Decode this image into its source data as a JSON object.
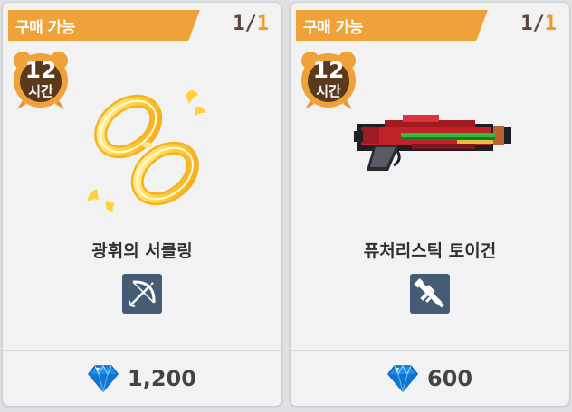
{
  "cards": [
    {
      "purchase_label": "구매 가능",
      "stock_current": "1",
      "stock_sep": "/",
      "stock_max": "1",
      "timer_value": "12",
      "timer_unit": "시간",
      "item_name": "광휘의 서클링",
      "type_icon": "bow-icon",
      "price": "1,200",
      "currency_icon": "diamond-icon"
    },
    {
      "purchase_label": "구매 가능",
      "stock_current": "1",
      "stock_sep": "/",
      "stock_max": "1",
      "timer_value": "12",
      "timer_unit": "시간",
      "item_name": "퓨처리스틱 토이건",
      "type_icon": "rifle-icon",
      "price": "600",
      "currency_icon": "diamond-icon"
    }
  ],
  "colors": {
    "banner": "#f0a23a",
    "stock_max": "#f39a21",
    "badge": "#455c74",
    "diamond": "#1e8ee8"
  }
}
